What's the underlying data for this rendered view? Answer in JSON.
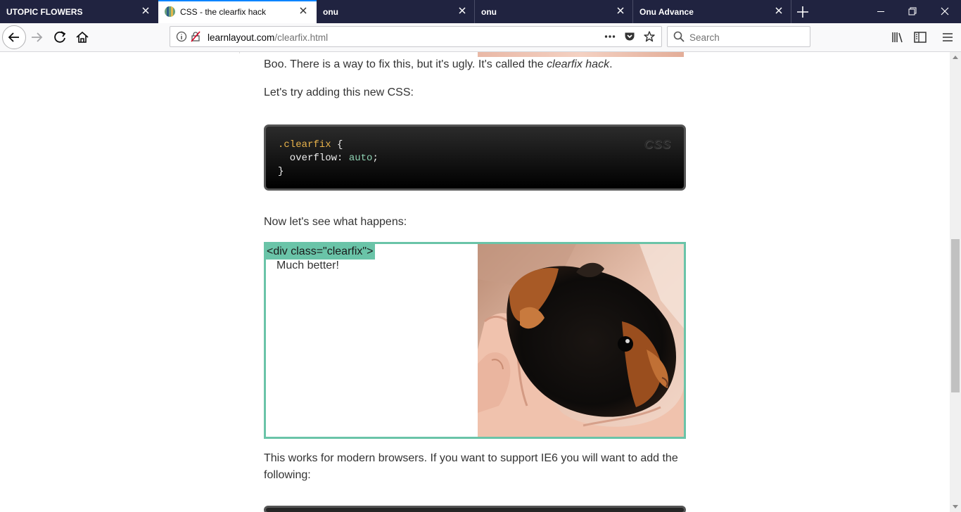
{
  "browser": {
    "tabs": [
      {
        "title": "UTOPIC FLOWERS",
        "active": false
      },
      {
        "title": "CSS - the clearfix hack",
        "active": true
      },
      {
        "title": "onu",
        "active": false
      },
      {
        "title": "onu",
        "active": false
      },
      {
        "title": "Onu Advance",
        "active": false
      }
    ],
    "url": {
      "host": "learnlayout.com",
      "path": "/clearfix.html"
    },
    "search_placeholder": "Search"
  },
  "page": {
    "para1": {
      "before": "Boo. There is a way to fix this, but it's ugly. It's called the ",
      "emphasis": "clearfix hack",
      "after": "."
    },
    "para2": "Let's try adding this new CSS:",
    "code": {
      "language": "CSS",
      "selector": ".clearfix",
      "open_brace": " {",
      "property": "  overflow: ",
      "value": "auto",
      "semicolon": ";",
      "close_brace": "}"
    },
    "para3": "Now let's see what happens:",
    "demo": {
      "tag_label": "<div class=\"clearfix\">",
      "text": "Much better!"
    },
    "para4": "This works for modern browsers. If you want to support IE6 you will want to add the following:"
  },
  "colors": {
    "accent_tab": "#0a84ff",
    "demo_border": "#6ac4a8",
    "code_selector": "#e8b24a",
    "code_value": "#8fd3b4"
  }
}
